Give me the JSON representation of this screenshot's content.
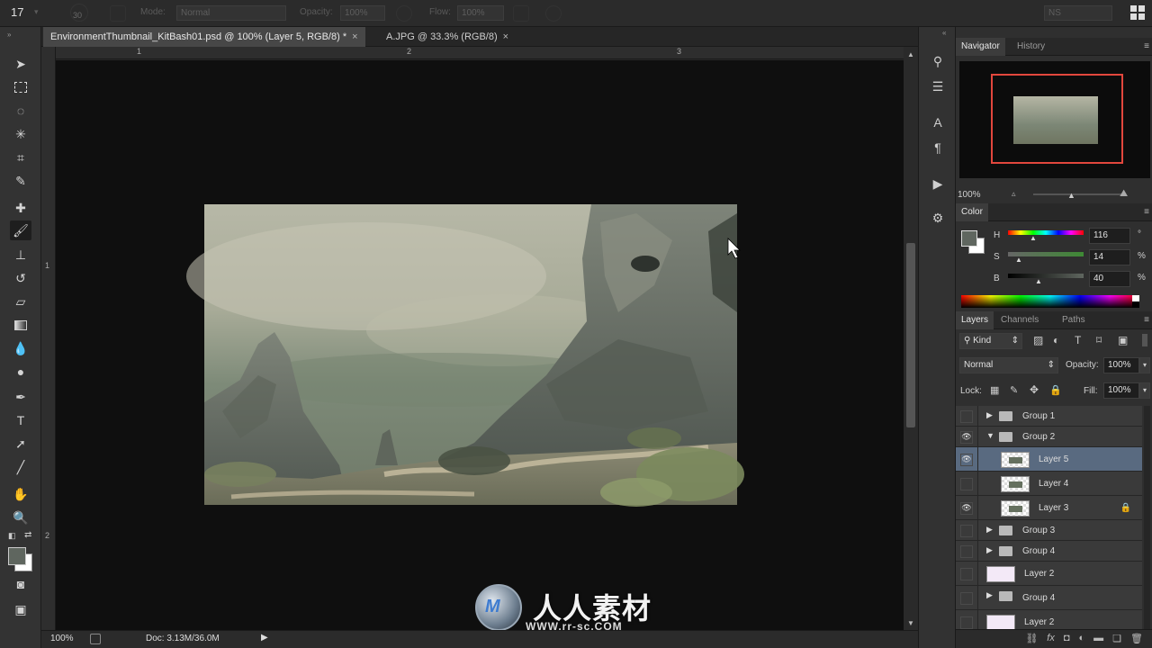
{
  "options_bar": {
    "tool_preset": "17",
    "brush_size": "30",
    "mode_label": "Mode:",
    "mode_value": "Normal",
    "opacity_label": "Opacity:",
    "opacity_value": "100%",
    "flow_label": "Flow:",
    "flow_value": "100%",
    "workspace_value": "NS"
  },
  "document_tabs": [
    {
      "label": "EnvironmentThumbnail_KitBash01.psd @ 100% (Layer 5, RGB/8) *",
      "active": true
    },
    {
      "label": "A.JPG @ 33.3% (RGB/8)",
      "active": false
    }
  ],
  "ruler": {
    "h_marks": [
      "1",
      "2",
      "3"
    ],
    "v_marks": [
      "1",
      "2"
    ]
  },
  "status_bar": {
    "zoom": "100%",
    "doc_info": "Doc: 3.13M/36.0M"
  },
  "navigator": {
    "tabs": [
      "Navigator",
      "History"
    ],
    "zoom": "100%"
  },
  "color_panel": {
    "title": "Color",
    "h_label": "H",
    "h_value": "116",
    "h_unit": "°",
    "s_label": "S",
    "s_value": "14",
    "s_unit": "%",
    "b_label": "B",
    "b_value": "40",
    "b_unit": "%",
    "foreground": "#5f665f",
    "background": "#ffffff"
  },
  "layers_panel": {
    "tabs": [
      "Layers",
      "Channels",
      "Paths"
    ],
    "filter_label": "Kind",
    "blend_mode": "Normal",
    "opacity_label": "Opacity:",
    "opacity_value": "100%",
    "lock_label": "Lock:",
    "fill_label": "Fill:",
    "fill_value": "100%",
    "layers": [
      {
        "name": "Group 1",
        "kind": "group",
        "visible": false,
        "expanded": false
      },
      {
        "name": "Group 2",
        "kind": "group",
        "visible": true,
        "expanded": true
      },
      {
        "name": "Layer 5",
        "kind": "layer",
        "visible": true,
        "selected": true,
        "indent": true
      },
      {
        "name": "Layer 4",
        "kind": "layer",
        "visible": false,
        "indent": true
      },
      {
        "name": "Layer 3",
        "kind": "layer",
        "visible": true,
        "indent": true,
        "locked": true
      },
      {
        "name": "Group 3",
        "kind": "group",
        "visible": false,
        "expanded": false
      },
      {
        "name": "Group 4",
        "kind": "group",
        "visible": false,
        "expanded": false
      },
      {
        "name": "Layer 2",
        "kind": "layer",
        "visible": false
      },
      {
        "name": "Group 4",
        "kind": "group",
        "visible": false,
        "expanded": false
      },
      {
        "name": "Layer 2",
        "kind": "layer",
        "visible": false
      }
    ]
  },
  "watermark": {
    "text": "人人素材",
    "url": "WWW.rr-sc.COM"
  }
}
